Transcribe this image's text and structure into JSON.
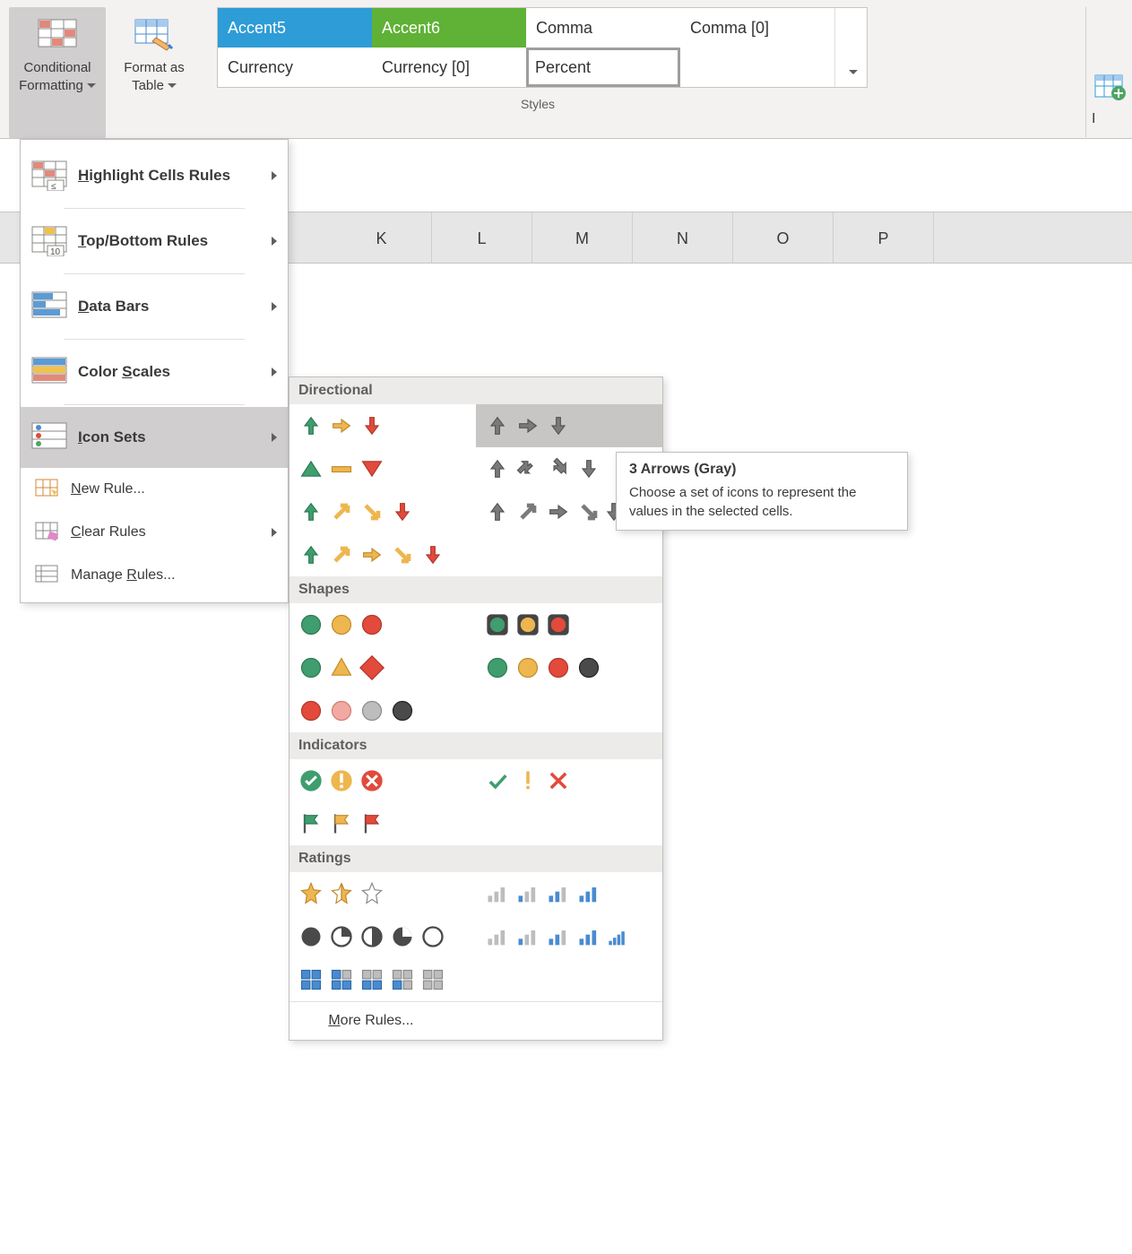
{
  "ribbon": {
    "conditional_formatting": "Conditional\nFormatting",
    "format_as_table": "Format as\nTable",
    "styles": {
      "accent5": "Accent5",
      "accent6": "Accent6",
      "comma": "Comma",
      "comma0": "Comma [0]",
      "currency": "Currency",
      "currency0": "Currency [0]",
      "percent": "Percent"
    },
    "group_label": "Styles",
    "right_peek_label": "I"
  },
  "columns": [
    "K",
    "L",
    "M",
    "N",
    "O",
    "P"
  ],
  "cf_menu": {
    "highlight": "Highlight Cells Rules",
    "topbottom": "Top/Bottom Rules",
    "databars": "Data Bars",
    "colorscales": "Color Scales",
    "iconsets": "Icon Sets",
    "new_rule": "New Rule...",
    "clear_rules": "Clear Rules",
    "manage_rules": "Manage Rules..."
  },
  "iconsets": {
    "cat_directional": "Directional",
    "cat_shapes": "Shapes",
    "cat_indicators": "Indicators",
    "cat_ratings": "Ratings",
    "more_rules": "More Rules..."
  },
  "tooltip": {
    "title": "3 Arrows (Gray)",
    "body": "Choose a set of icons to represent the values in the selected cells."
  }
}
